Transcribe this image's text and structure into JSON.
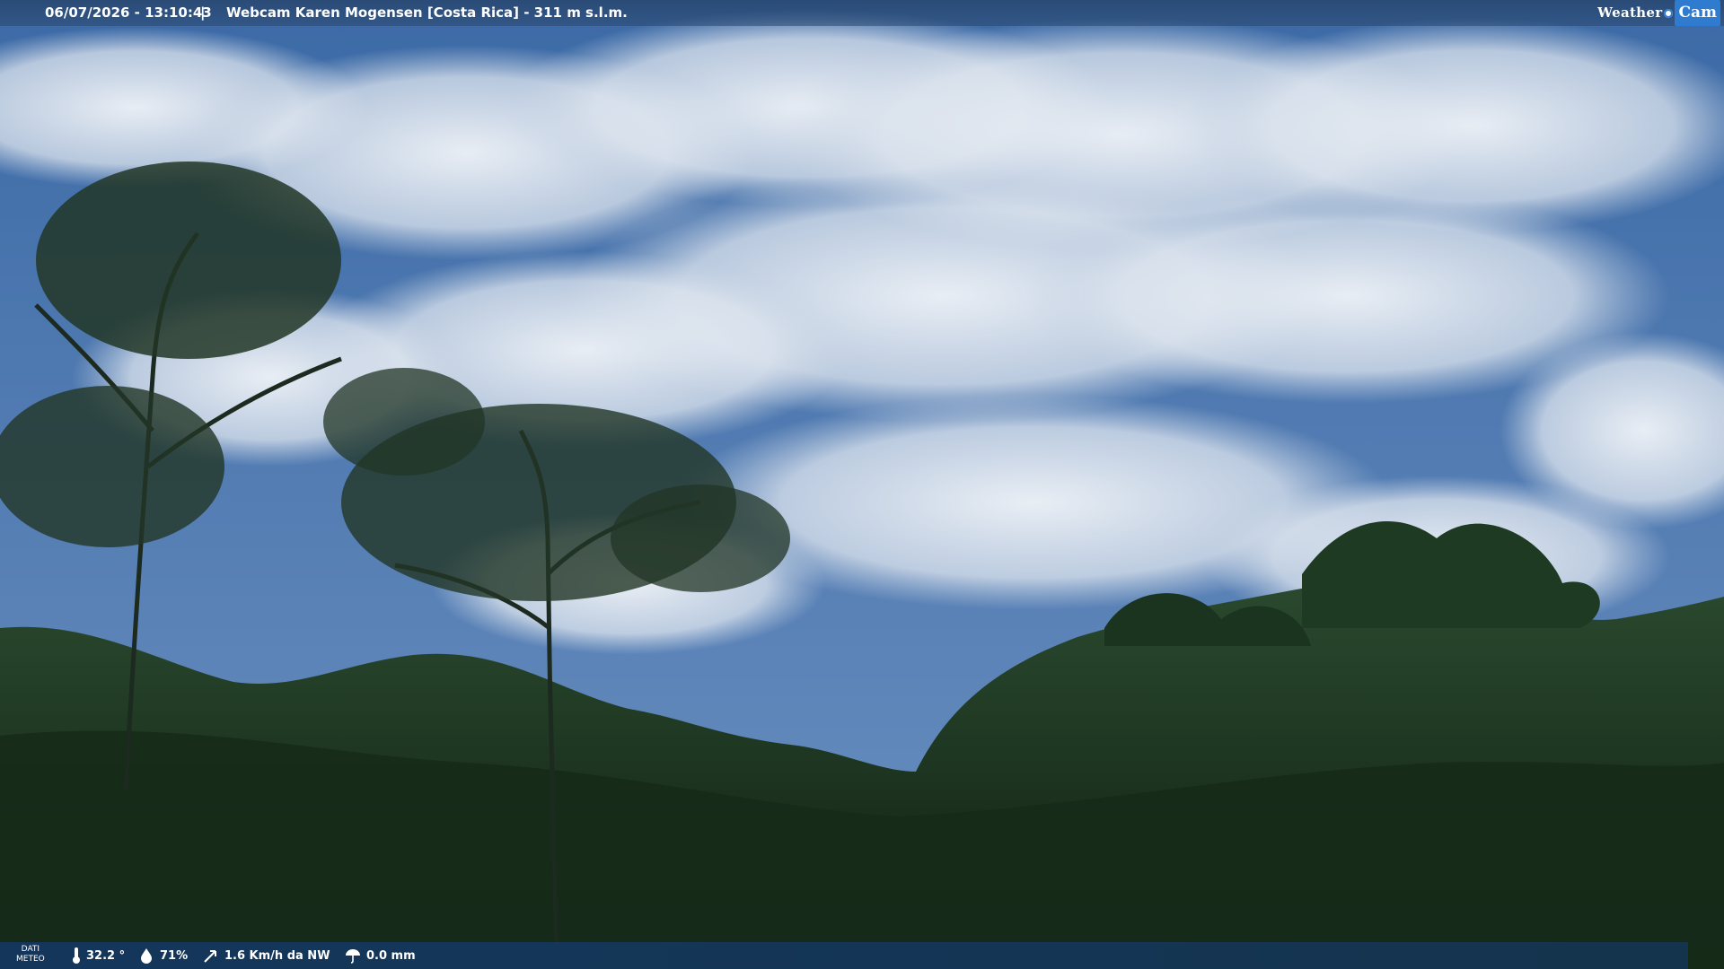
{
  "overlay": {
    "timestamp": "06/07/2026 - 13:10:43",
    "separator": "|",
    "title": "Webcam Karen Mogensen [Costa Rica]  - 311 m s.l.m.",
    "logo_weather": "Weather",
    "logo_cam": "Cam"
  },
  "weather_bar": {
    "label_line1": "DATI",
    "label_line2": "METEO",
    "temperature": "32.2 °",
    "humidity": "71%",
    "wind": "1.6 Km/h da NW",
    "rain": "0.0 mm",
    "icons": [
      "thermometer-icon",
      "humidity-icon",
      "wind-icon",
      "rain-icon"
    ]
  },
  "colors": {
    "sky_top": "#3f6ea8",
    "sky_bottom": "#5d84b8",
    "cloud": "#e9eef4",
    "forest_dark": "#132614",
    "forest_mid": "#24412a",
    "bar_bg": "#14375f",
    "logo_accent": "#2e7bd0"
  }
}
